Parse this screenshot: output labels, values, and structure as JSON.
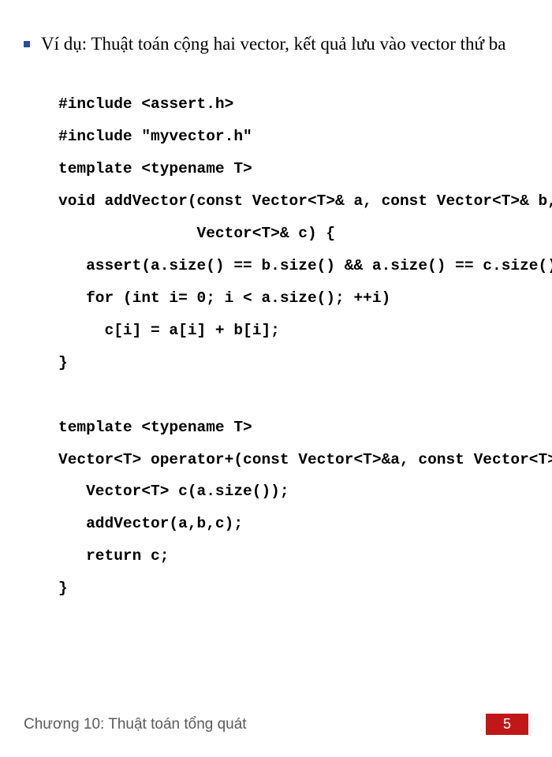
{
  "header": {
    "title": "Ví dụ: Thuật toán cộng hai vector, kết quả lưu vào vector thứ ba"
  },
  "code": {
    "content": "#include <assert.h>\n#include \"myvector.h\"\ntemplate <typename T>\nvoid addVector(const Vector<T>& a, const Vector<T>& b,\n               Vector<T>& c) {\n   assert(a.size() == b.size() && a.size() == c.size());\n   for (int i= 0; i < a.size(); ++i)\n     c[i] = a[i] + b[i];\n}\n\ntemplate <typename T>\nVector<T> operator+(const Vector<T>&a, const Vector<T>& b) {\n   Vector<T> c(a.size());\n   addVector(a,b,c);\n   return c;\n}"
  },
  "footer": {
    "chapter": "Chương 10: Thuật toán tổng quát",
    "page": "5"
  }
}
